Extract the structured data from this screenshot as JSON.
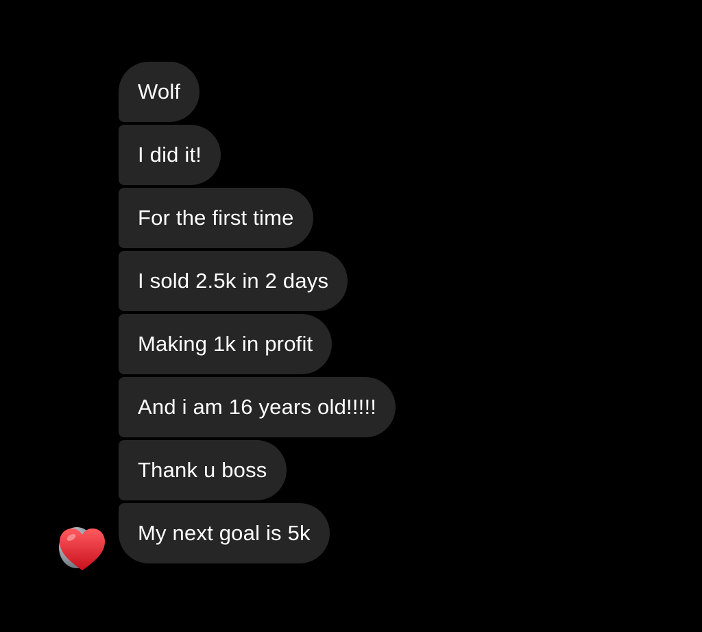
{
  "conversation": {
    "messages": [
      {
        "text": "Wolf"
      },
      {
        "text": "I did it!"
      },
      {
        "text": "For the first time"
      },
      {
        "text": "I sold 2.5k in 2 days"
      },
      {
        "text": "Making 1k in profit"
      },
      {
        "text": "And i am 16 years old!!!!!"
      },
      {
        "text": "Thank u boss"
      },
      {
        "text": "My next goal is 5k"
      }
    ],
    "reaction": {
      "icon": "heart-icon",
      "emoji": "❤️"
    }
  },
  "colors": {
    "background": "#000000",
    "bubble": "#262626",
    "text": "#ffffff",
    "heart": "#e8232e"
  }
}
